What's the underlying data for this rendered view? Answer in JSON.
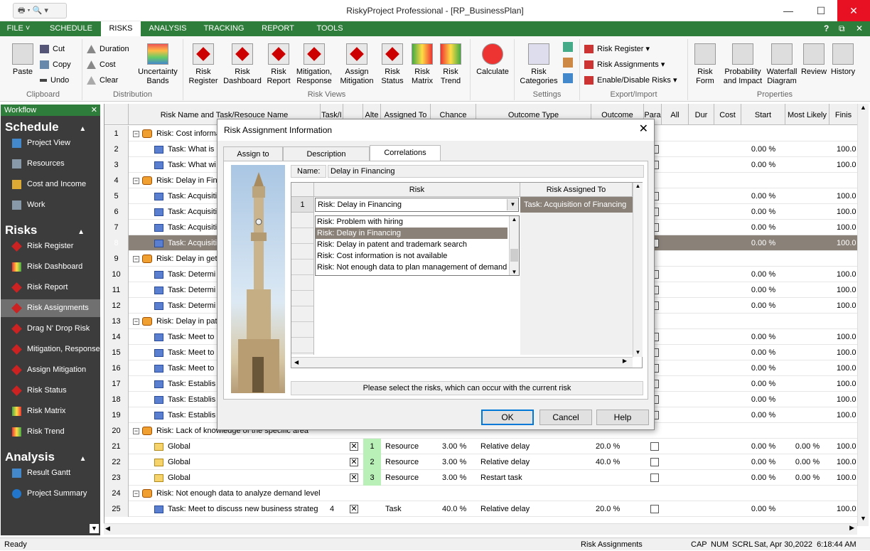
{
  "window": {
    "title": "RiskyProject Professional - [RP_BusinessPlan]",
    "min": "—",
    "max": "☐",
    "close": "✕"
  },
  "menu": {
    "tabs": [
      "FILE",
      "SCHEDULE",
      "RISKS",
      "ANALYSIS",
      "TRACKING",
      "REPORT",
      "TOOLS"
    ],
    "active": "RISKS",
    "help": "?"
  },
  "ribbon": {
    "clipboard": {
      "paste": "Paste",
      "cut": "Cut",
      "copy": "Copy",
      "undo": "Undo",
      "label": "Clipboard"
    },
    "distribution": {
      "duration": "Duration",
      "cost": "Cost",
      "clear": "Clear",
      "uncertainty": "Uncertainty Bands",
      "label": "Distribution"
    },
    "views": {
      "items": [
        "Risk Register",
        "Risk Dashboard",
        "Risk Report",
        "Mitigation, Response",
        "Assign Mitigation",
        "Risk Status",
        "Risk Matrix",
        "Risk Trend"
      ],
      "label": "Risk Views"
    },
    "calculate": "Calculate",
    "settings": {
      "categories": "Risk Categories",
      "label": "Settings"
    },
    "export": {
      "register": "Risk Register",
      "assignments": "Risk Assignments",
      "enable": "Enable/Disable Risks",
      "label": "Export/Import"
    },
    "properties": {
      "items": [
        "Risk Form",
        "Probability and Impact",
        "Waterfall Diagram",
        "Review",
        "History"
      ],
      "label": "Properties"
    }
  },
  "workflow": {
    "header": "Workflow",
    "sections": [
      {
        "title": "Schedule",
        "items": [
          "View",
          "Resources",
          "Cost and Income",
          "Work"
        ]
      },
      {
        "title": "Risks",
        "items": [
          "Risk Register",
          "Risk Dashboard",
          "Risk Report",
          "Risk Assignments",
          "Drag N' Drop Risk",
          "Mitigation, Response",
          "Assign Mitigation",
          "Risk Status",
          "Risk Matrix",
          "Risk Trend"
        ]
      },
      {
        "title": "Analysis",
        "items": [
          "Result Gantt",
          "Project Summary"
        ]
      }
    ],
    "selected": "Risk Assignments"
  },
  "grid": {
    "columns": [
      "",
      "Risk Name and Task/Resouce Name",
      "Task/I",
      "",
      "Alte",
      "Assigned To",
      "Chance",
      "Outcome Type",
      "Outcome",
      "Para",
      "All",
      "Dur",
      "Cost",
      "Start",
      "Most Likely",
      "Finis"
    ],
    "rows": [
      {
        "n": "1",
        "kind": "risk",
        "name": "Risk: Cost informa"
      },
      {
        "n": "2",
        "kind": "task",
        "name": "Task: What is",
        "start": "0.00 %",
        "fin": "100.0"
      },
      {
        "n": "3",
        "kind": "task",
        "name": "Task: What wi",
        "start": "0.00 %",
        "fin": "100.0"
      },
      {
        "n": "4",
        "kind": "risk",
        "name": "Risk: Delay in Fina"
      },
      {
        "n": "5",
        "kind": "task",
        "name": "Task: Acquisiti",
        "start": "0.00 %",
        "fin": "100.0"
      },
      {
        "n": "6",
        "kind": "task",
        "name": "Task: Acquisiti",
        "start": "0.00 %",
        "fin": "100.0"
      },
      {
        "n": "7",
        "kind": "task",
        "name": "Task: Acquisiti",
        "start": "0.00 %",
        "fin": "100.0"
      },
      {
        "n": "8",
        "kind": "task",
        "name": "Task: Acquisiti",
        "start": "0.00 %",
        "fin": "100.0",
        "hl": true
      },
      {
        "n": "9",
        "kind": "risk",
        "name": "Risk: Delay in gett"
      },
      {
        "n": "10",
        "kind": "task",
        "name": "Task: Determi",
        "start": "0.00 %",
        "fin": "100.0"
      },
      {
        "n": "11",
        "kind": "task",
        "name": "Task: Determi",
        "start": "0.00 %",
        "fin": "100.0"
      },
      {
        "n": "12",
        "kind": "task",
        "name": "Task: Determi",
        "start": "0.00 %",
        "fin": "100.0"
      },
      {
        "n": "13",
        "kind": "risk",
        "name": "Risk: Delay in pate"
      },
      {
        "n": "14",
        "kind": "task",
        "name": "Task: Meet to",
        "start": "0.00 %",
        "fin": "100.0"
      },
      {
        "n": "15",
        "kind": "task",
        "name": "Task: Meet to",
        "start": "0.00 %",
        "fin": "100.0"
      },
      {
        "n": "16",
        "kind": "task",
        "name": "Task: Meet to",
        "start": "0.00 %",
        "fin": "100.0"
      },
      {
        "n": "17",
        "kind": "task",
        "name": "Task: Establis",
        "start": "0.00 %",
        "fin": "100.0"
      },
      {
        "n": "18",
        "kind": "task",
        "name": "Task: Establis",
        "start": "0.00 %",
        "fin": "100.0"
      },
      {
        "n": "19",
        "kind": "task",
        "name": "Task: Establis",
        "start": "0.00 %",
        "fin": "100.0"
      },
      {
        "n": "20",
        "kind": "risk",
        "name": "Risk: Lack of knowledge of the specific area"
      },
      {
        "n": "21",
        "kind": "global",
        "name": "Global",
        "alt": "1",
        "assigned": "Resource",
        "chance": "3.00 %",
        "otype": "Relative delay",
        "outcome": "20.0 %",
        "start": "0.00 %",
        "ml": "0.00 %",
        "fin": "100.0"
      },
      {
        "n": "22",
        "kind": "global",
        "name": "Global",
        "alt": "2",
        "assigned": "Resource",
        "chance": "3.00 %",
        "otype": "Relative delay",
        "outcome": "40.0 %",
        "start": "0.00 %",
        "ml": "0.00 %",
        "fin": "100.0"
      },
      {
        "n": "23",
        "kind": "global",
        "name": "Global",
        "alt": "3",
        "assigned": "Resource",
        "chance": "3.00 %",
        "otype": "Restart task",
        "outcome": "",
        "start": "0.00 %",
        "ml": "0.00 %",
        "fin": "100.0"
      },
      {
        "n": "24",
        "kind": "risk",
        "name": "Risk: Not enough data to analyze demand level"
      },
      {
        "n": "25",
        "kind": "task",
        "name": "Task: Meet to discuss new business strateg",
        "task": "4",
        "assigned": "Task",
        "chance": "40.0 %",
        "otype": "Relative delay",
        "outcome": "20.0 %",
        "start": "0.00 %",
        "fin": "100.0"
      }
    ]
  },
  "dialog": {
    "title": "Risk Assignment Information",
    "close": "✕",
    "tabs": [
      "Assign to",
      "Description",
      "Correlations"
    ],
    "active_tab": "Correlations",
    "name_label": "Name:",
    "name_value": "Delay in Financing",
    "col_risk": "Risk",
    "col_assigned": "Risk Assigned To",
    "row1": {
      "n": "1",
      "risk": "Risk: Delay in Financing",
      "assigned": "Task: Acquisition of Financing"
    },
    "dropdown": [
      "Risk: Problem with hiring",
      "Risk: Delay in Financing",
      "Risk: Delay in patent and trademark search",
      "Risk: Cost information is not available",
      "Risk: Not enough data to plan management of demand"
    ],
    "dropdown_selected": "Risk: Delay in Financing",
    "hint": "Please select the risks, which can occur with the current risk",
    "ok": "OK",
    "cancel": "Cancel",
    "help": "Help"
  },
  "status": {
    "left": "Ready",
    "view": "Risk Assignments",
    "caps": "CAP",
    "num": "NUM",
    "scrl": "SCRL",
    "datetime": "Sat, Apr 30,2022  6:18:44 AM"
  }
}
